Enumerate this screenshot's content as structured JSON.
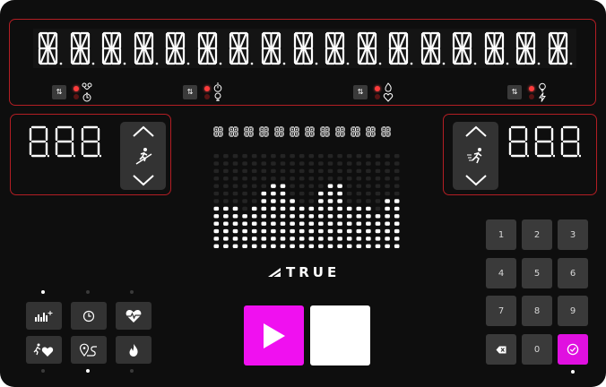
{
  "colors": {
    "accent_red": "#b31e24",
    "led_red": "#ff3b3b",
    "start_magenta": "#f010f0",
    "panel": "#0e0e0e"
  },
  "message_display": {
    "character_count": 17
  },
  "stats": [
    {
      "name": "stat-group-1",
      "icons": [
        "distance-icon",
        "timer-icon"
      ]
    },
    {
      "name": "stat-group-2",
      "icons": [
        "stopwatch-icon",
        "location-icon"
      ]
    },
    {
      "name": "stat-group-3",
      "icons": [
        "calories-icon",
        "heart-icon"
      ]
    },
    {
      "name": "stat-group-4",
      "icons": [
        "lightbulb-icon",
        "power-icon"
      ]
    }
  ],
  "incline": {
    "icon": "incline-runner-icon"
  },
  "speed": {
    "icon": "speed-runner-icon"
  },
  "brand": {
    "name": "TRUE"
  },
  "controls": {
    "start_icon": "play-icon",
    "stop_icon": "stop-icon"
  },
  "programs": [
    {
      "icon": "bar-chart-plus-icon"
    },
    {
      "icon": "clock-icon"
    },
    {
      "icon": "heart-rate-icon"
    },
    {
      "icon": "heart-runner-icon"
    },
    {
      "icon": "map-route-icon"
    },
    {
      "icon": "flame-icon"
    }
  ],
  "keypad": {
    "keys": [
      "1",
      "2",
      "3",
      "4",
      "5",
      "6",
      "7",
      "8",
      "9",
      "",
      "0",
      ""
    ],
    "clear_icon": "backspace-icon",
    "enter_icon": "check-circle-icon"
  }
}
